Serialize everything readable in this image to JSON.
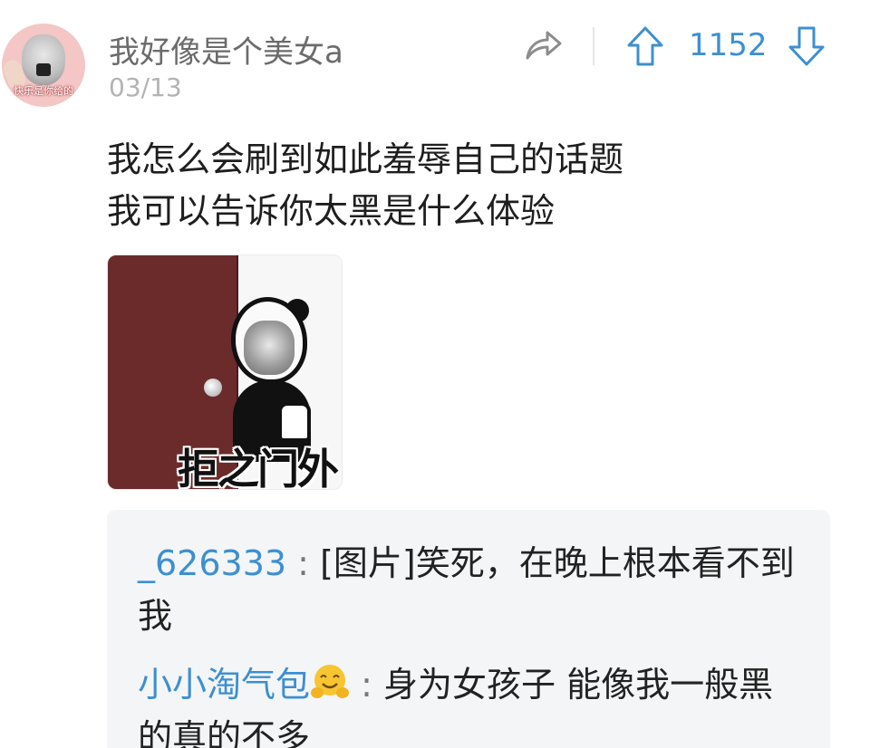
{
  "post": {
    "username": "我好像是个美女a",
    "date": "03/13",
    "score": "1152",
    "text_lines": [
      "我怎么会刷到如此羞辱自己的话题",
      "我可以告诉你太黑是什么体验"
    ],
    "avatar_caption": "快乐是你给的",
    "image": {
      "caption": "拒之门外"
    },
    "icons": {
      "share": "share-icon",
      "upvote": "arrow-up-icon",
      "downvote": "arrow-down-icon"
    },
    "colors": {
      "accent": "#3d8fd1",
      "username": "#6b6b6b",
      "date": "#b3b3b3",
      "reply_background": "#f3f5f7"
    }
  },
  "replies": [
    {
      "author": "_626333",
      "separator": ":",
      "text": "[图片]笑死，在晚上根本看不到我"
    },
    {
      "author": "小小淘气包",
      "author_emoji": "hugging-face-emoji",
      "separator": ":",
      "text": "身为女孩子 能像我一般黑的真的不多"
    }
  ]
}
